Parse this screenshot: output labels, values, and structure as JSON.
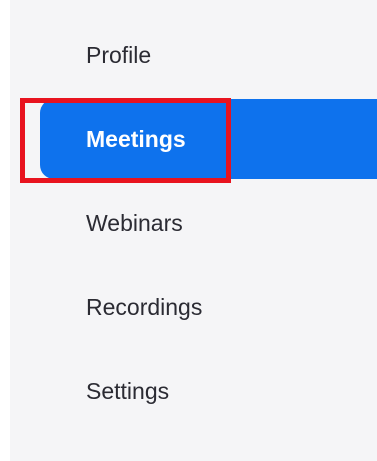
{
  "nav": {
    "items": [
      {
        "label": "Profile"
      },
      {
        "label": "Meetings",
        "active": true
      },
      {
        "label": "Webinars"
      },
      {
        "label": "Recordings"
      },
      {
        "label": "Settings"
      }
    ]
  },
  "colors": {
    "active_bg": "#0e72ed",
    "highlight_border": "#e8131f",
    "sidebar_bg": "#f5f5f7",
    "text": "#2b2b33"
  }
}
